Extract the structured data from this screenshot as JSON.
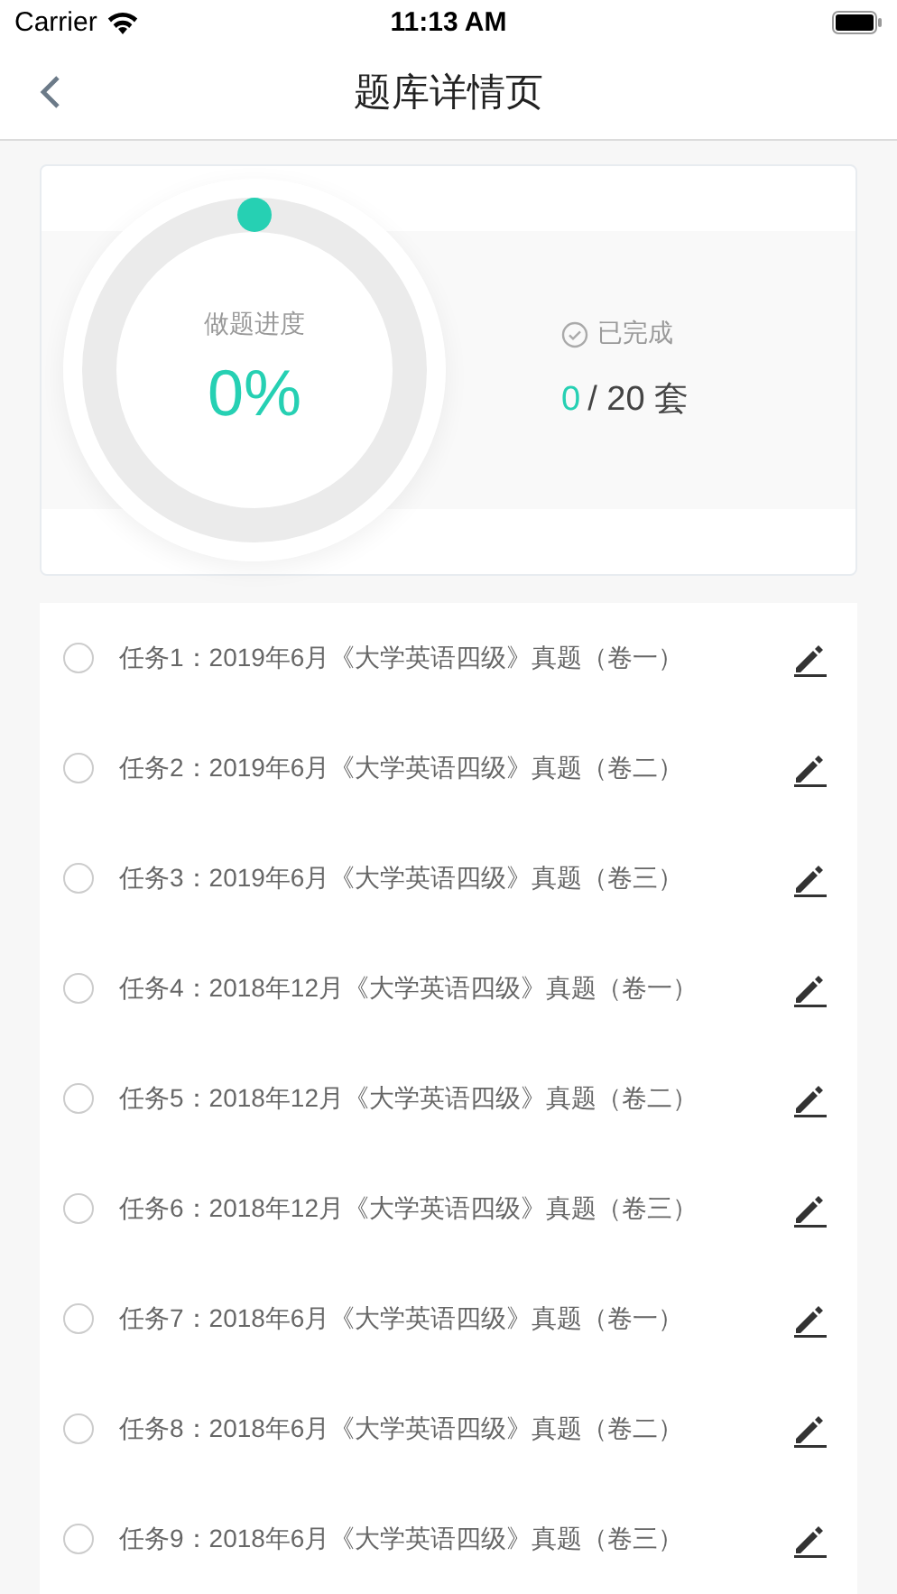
{
  "status_bar": {
    "carrier": "Carrier",
    "time": "11:13 AM"
  },
  "nav": {
    "title": "题库详情页"
  },
  "progress": {
    "label": "做题进度",
    "percent": "0%",
    "done_label": "已完成",
    "done_count": "0",
    "total": "/ 20 套"
  },
  "tasks": [
    {
      "title": "任务1：2019年6月《大学英语四级》真题（卷一）",
      "checked": false
    },
    {
      "title": "任务2：2019年6月《大学英语四级》真题（卷二）",
      "checked": false
    },
    {
      "title": "任务3：2019年6月《大学英语四级》真题（卷三）",
      "checked": false
    },
    {
      "title": "任务4：2018年12月《大学英语四级》真题（卷一）",
      "checked": false
    },
    {
      "title": "任务5：2018年12月《大学英语四级》真题（卷二）",
      "checked": false
    },
    {
      "title": "任务6：2018年12月《大学英语四级》真题（卷三）",
      "checked": false
    },
    {
      "title": "任务7：2018年6月《大学英语四级》真题（卷一）",
      "checked": false
    },
    {
      "title": "任务8：2018年6月《大学英语四级》真题（卷二）",
      "checked": false
    },
    {
      "title": "任务9：2018年6月《大学英语四级》真题（卷三）",
      "checked": false
    }
  ]
}
